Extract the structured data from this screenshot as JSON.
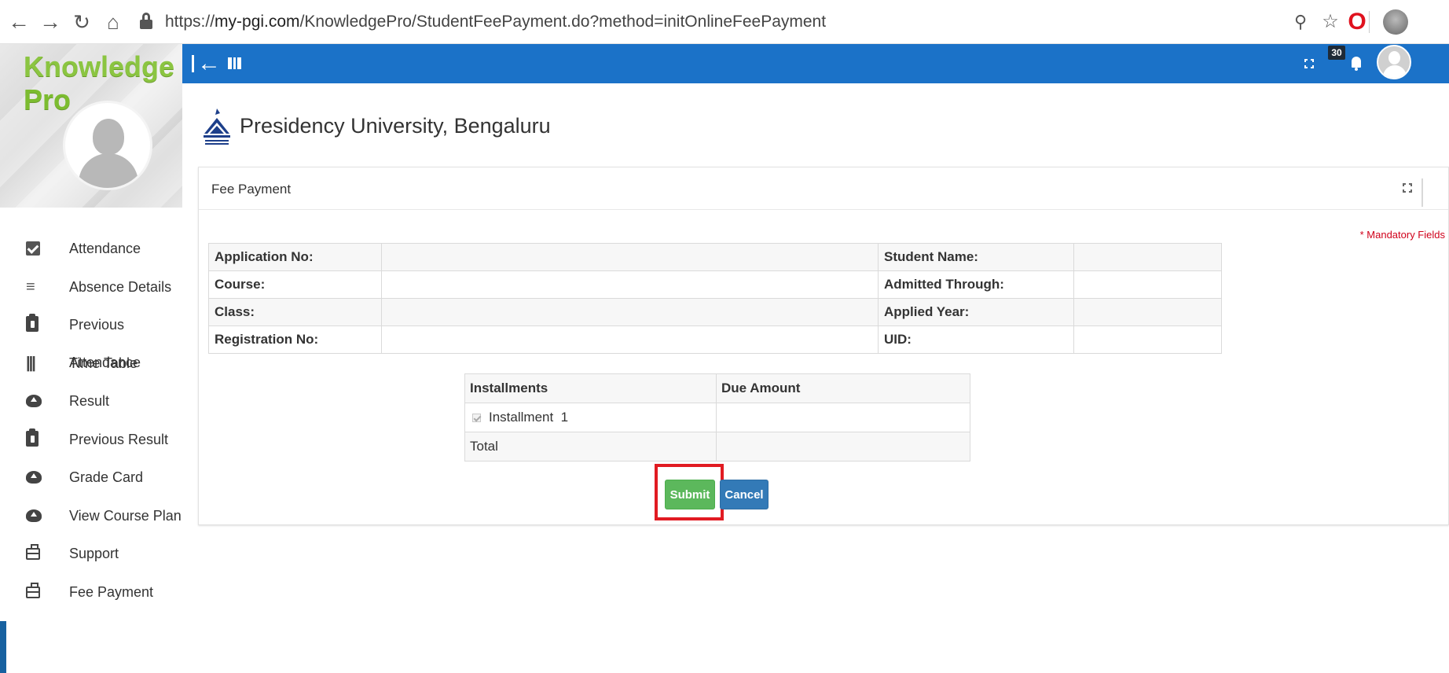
{
  "browser": {
    "url_prefix": "https://",
    "url_host": "my-pgi.com",
    "url_path": "/KnowledgePro/StudentFeePayment.do?method=initOnlineFeePayment",
    "icons": [
      "back-arrow-icon",
      "forward-arrow-icon",
      "reload-icon",
      "home-icon",
      "lock-icon",
      "zoom-icon",
      "star-icon",
      "opera-icon",
      "profile-avatar-icon"
    ]
  },
  "app": {
    "brand_part1": "Knowledge",
    "brand_part2": "Pro",
    "brand_color": "#8bc541",
    "appbar_color": "#1b72c8",
    "notification_count": "30"
  },
  "sidebar": {
    "items": [
      {
        "label": "Attendance",
        "icon": "checkbox-icon"
      },
      {
        "label": "Absence Details",
        "icon": "list-check-icon"
      },
      {
        "label": "Previous Attendance",
        "icon": "clipboard-icon"
      },
      {
        "label": "Time Table",
        "icon": "columns-icon"
      },
      {
        "label": "Result",
        "icon": "cloud-upload-icon"
      },
      {
        "label": "Previous Result",
        "icon": "clipboard-icon"
      },
      {
        "label": "Grade Card",
        "icon": "cloud-upload-icon"
      },
      {
        "label": "View Course Plan",
        "icon": "cloud-upload-icon"
      },
      {
        "label": "Support",
        "icon": "briefcase-icon"
      },
      {
        "label": "Fee Payment",
        "icon": "briefcase-icon"
      }
    ]
  },
  "university": {
    "name": "Presidency University, Bengaluru"
  },
  "panel": {
    "title": "Fee Payment",
    "mandatory_note": "* Mandatory Fields",
    "mandatory_color": "#d0021b"
  },
  "info": {
    "application_no_label": "Application No:",
    "student_name_label": "Student Name:",
    "course_label": "Course:",
    "admitted_through_label": "Admitted Through:",
    "class_label": "Class:",
    "applied_year_label": "Applied Year:",
    "registration_no_label": "Registration No:",
    "uid_label": "UID:"
  },
  "installments": {
    "header_installments": "Installments",
    "header_due_amount": "Due Amount",
    "row_label": "Installment",
    "row_number": "1",
    "row_checked": true,
    "total_label": "Total"
  },
  "actions": {
    "submit_label": "Submit",
    "cancel_label": "Cancel",
    "submit_color": "#5cb85c",
    "cancel_color": "#337ab7",
    "highlight_color": "#e11b22"
  }
}
